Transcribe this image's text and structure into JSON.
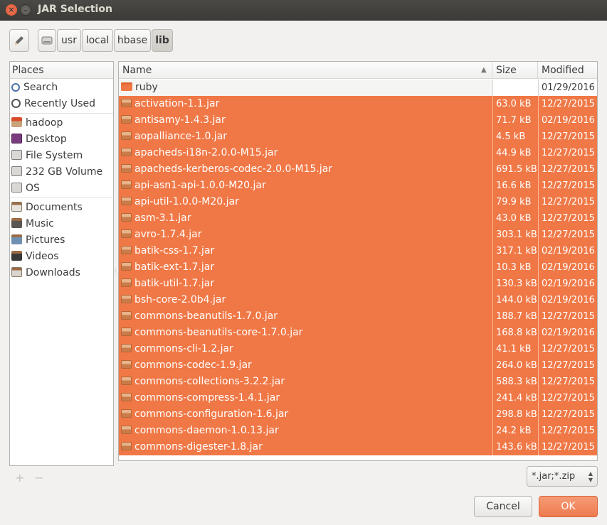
{
  "window": {
    "title": "JAR Selection",
    "close_glyph": "×",
    "minimize_glyph": "–"
  },
  "pathbar": {
    "edit_icon": "pencil-icon",
    "segments": [
      "usr",
      "local",
      "hbase",
      "lib"
    ],
    "active": "lib"
  },
  "places": {
    "header": "Places",
    "items": [
      {
        "label": "Search",
        "icon": "search-icon"
      },
      {
        "label": "Recently Used",
        "icon": "recent-icon"
      },
      {
        "label": "hadoop",
        "icon": "home-icon"
      },
      {
        "label": "Desktop",
        "icon": "desktop-icon"
      },
      {
        "label": "File System",
        "icon": "filesystem-icon"
      },
      {
        "label": "232 GB Volume",
        "icon": "drive-icon"
      },
      {
        "label": "OS",
        "icon": "drive-icon"
      },
      {
        "label": "Documents",
        "icon": "documents-icon"
      },
      {
        "label": "Music",
        "icon": "music-icon"
      },
      {
        "label": "Pictures",
        "icon": "pictures-icon"
      },
      {
        "label": "Videos",
        "icon": "videos-icon"
      },
      {
        "label": "Downloads",
        "icon": "downloads-icon"
      }
    ],
    "add_glyph": "+",
    "remove_glyph": "−"
  },
  "filelist": {
    "columns": {
      "name": "Name",
      "size": "Size",
      "modified": "Modified"
    },
    "sort_glyph": "▲",
    "rows": [
      {
        "name": "ruby",
        "size": "",
        "modified": "01/29/2016",
        "type": "folder"
      },
      {
        "name": "activation-1.1.jar",
        "size": "63.0 kB",
        "modified": "12/27/2015",
        "type": "jar"
      },
      {
        "name": "antisamy-1.4.3.jar",
        "size": "71.7 kB",
        "modified": "02/19/2016",
        "type": "jar"
      },
      {
        "name": "aopalliance-1.0.jar",
        "size": "4.5 kB",
        "modified": "12/27/2015",
        "type": "jar"
      },
      {
        "name": "apacheds-i18n-2.0.0-M15.jar",
        "size": "44.9 kB",
        "modified": "12/27/2015",
        "type": "jar"
      },
      {
        "name": "apacheds-kerberos-codec-2.0.0-M15.jar",
        "size": "691.5 kB",
        "modified": "12/27/2015",
        "type": "jar"
      },
      {
        "name": "api-asn1-api-1.0.0-M20.jar",
        "size": "16.6 kB",
        "modified": "12/27/2015",
        "type": "jar"
      },
      {
        "name": "api-util-1.0.0-M20.jar",
        "size": "79.9 kB",
        "modified": "12/27/2015",
        "type": "jar"
      },
      {
        "name": "asm-3.1.jar",
        "size": "43.0 kB",
        "modified": "12/27/2015",
        "type": "jar"
      },
      {
        "name": "avro-1.7.4.jar",
        "size": "303.1 kB",
        "modified": "12/27/2015",
        "type": "jar"
      },
      {
        "name": "batik-css-1.7.jar",
        "size": "317.1 kB",
        "modified": "02/19/2016",
        "type": "jar"
      },
      {
        "name": "batik-ext-1.7.jar",
        "size": "10.3 kB",
        "modified": "02/19/2016",
        "type": "jar"
      },
      {
        "name": "batik-util-1.7.jar",
        "size": "130.3 kB",
        "modified": "02/19/2016",
        "type": "jar"
      },
      {
        "name": "bsh-core-2.0b4.jar",
        "size": "144.0 kB",
        "modified": "02/19/2016",
        "type": "jar"
      },
      {
        "name": "commons-beanutils-1.7.0.jar",
        "size": "188.7 kB",
        "modified": "12/27/2015",
        "type": "jar"
      },
      {
        "name": "commons-beanutils-core-1.7.0.jar",
        "size": "168.8 kB",
        "modified": "02/19/2016",
        "type": "jar"
      },
      {
        "name": "commons-cli-1.2.jar",
        "size": "41.1 kB",
        "modified": "12/27/2015",
        "type": "jar"
      },
      {
        "name": "commons-codec-1.9.jar",
        "size": "264.0 kB",
        "modified": "12/27/2015",
        "type": "jar"
      },
      {
        "name": "commons-collections-3.2.2.jar",
        "size": "588.3 kB",
        "modified": "12/27/2015",
        "type": "jar"
      },
      {
        "name": "commons-compress-1.4.1.jar",
        "size": "241.4 kB",
        "modified": "12/27/2015",
        "type": "jar"
      },
      {
        "name": "commons-configuration-1.6.jar",
        "size": "298.8 kB",
        "modified": "12/27/2015",
        "type": "jar"
      },
      {
        "name": "commons-daemon-1.0.13.jar",
        "size": "24.2 kB",
        "modified": "12/27/2015",
        "type": "jar"
      },
      {
        "name": "commons-digester-1.8.jar",
        "size": "143.6 kB",
        "modified": "12/27/2015",
        "type": "jar"
      }
    ]
  },
  "filter": {
    "value": "*.jar;*.zip",
    "updown_glyph": "▲▼"
  },
  "buttons": {
    "cancel": "Cancel",
    "ok": "OK"
  },
  "colors": {
    "selection": "#f07846",
    "accent": "#ef7b4f"
  }
}
